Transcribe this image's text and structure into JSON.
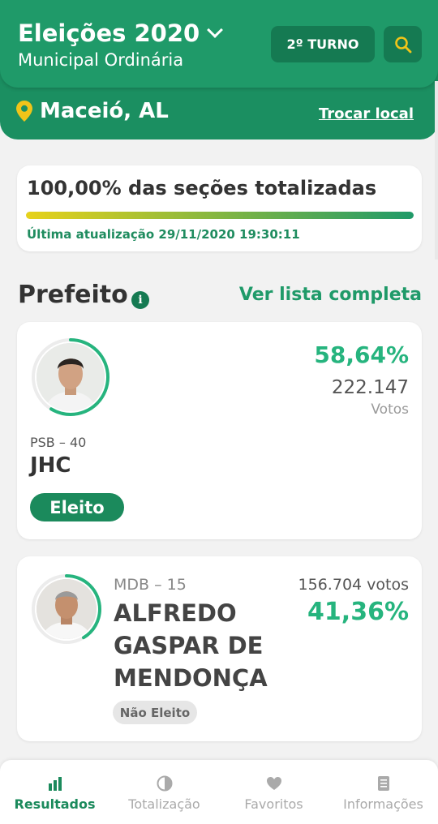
{
  "header": {
    "title": "Eleições 2020",
    "subtitle": "Municipal Ordinária",
    "turno_label": "2º TURNO",
    "location": "Maceió, AL",
    "change_location": "Trocar local"
  },
  "progress": {
    "title": "100,00% das seções totalizadas",
    "percent": 100,
    "last_update": "Última atualização 29/11/2020 19:30:11"
  },
  "section": {
    "title": "Prefeito",
    "info_icon": "info-icon",
    "see_all": "Ver lista completa"
  },
  "candidates": [
    {
      "party": "PSB – 40",
      "name": "JHC",
      "percent": "58,64%",
      "votes": "222.147",
      "votes_label": "Votos",
      "status": "Eleito",
      "share": 0.5864
    },
    {
      "party": "MDB – 15",
      "name": "ALFREDO GASPAR DE MENDONÇA",
      "percent": "41,36%",
      "votes": "156.704 votos",
      "status": "Não Eleito",
      "share": 0.4136
    }
  ],
  "nav": {
    "items": [
      {
        "label": "Resultados",
        "icon": "bar-chart-icon",
        "active": true
      },
      {
        "label": "Totalização",
        "icon": "pie-chart-icon",
        "active": false
      },
      {
        "label": "Favoritos",
        "icon": "heart-icon",
        "active": false
      },
      {
        "label": "Informações",
        "icon": "document-icon",
        "active": false
      }
    ]
  },
  "colors": {
    "primary": "#1f9a69",
    "primary_dark": "#157a52",
    "accent_yellow": "#e7c21a",
    "percent_green": "#26b47e"
  }
}
